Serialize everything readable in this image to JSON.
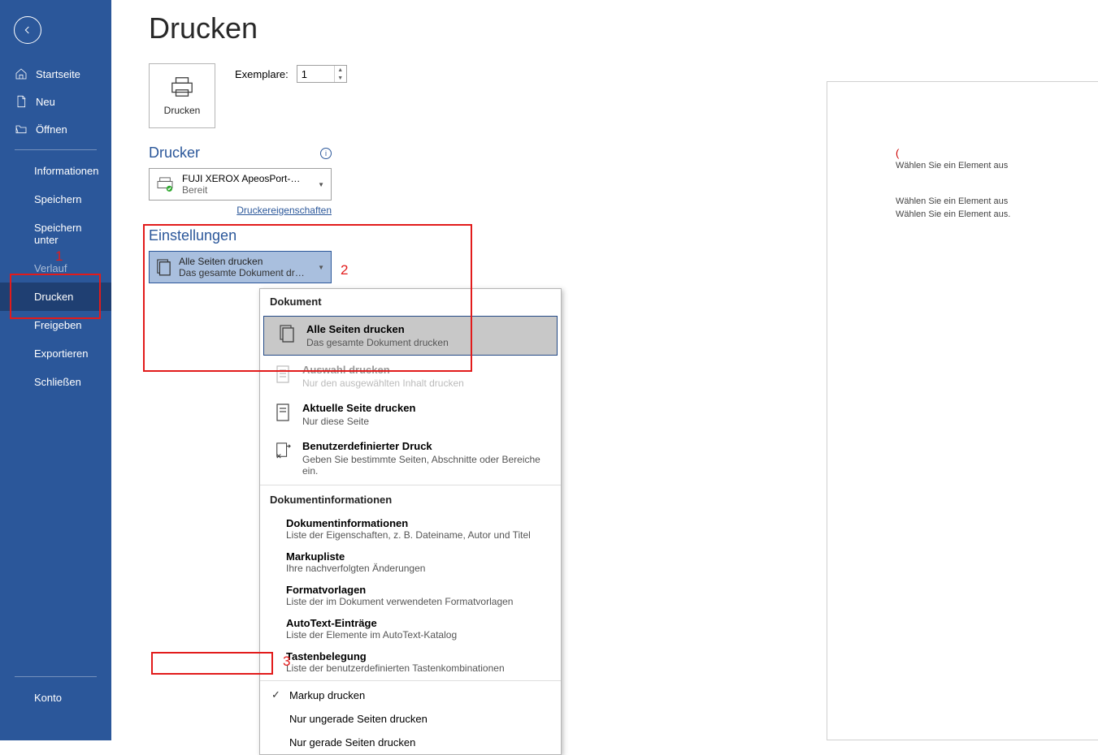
{
  "sidebar": {
    "items_icon": [
      {
        "label": "Startseite",
        "icon": "home"
      },
      {
        "label": "Neu",
        "icon": "page"
      },
      {
        "label": "Öffnen",
        "icon": "folder"
      }
    ],
    "items_text": [
      {
        "label": "Informationen"
      },
      {
        "label": "Speichern"
      },
      {
        "label": "Speichern unter"
      },
      {
        "label": "Verlauf",
        "dim": true
      },
      {
        "label": "Drucken",
        "active": true
      },
      {
        "label": "Freigeben"
      },
      {
        "label": "Exportieren"
      },
      {
        "label": "Schließen"
      }
    ],
    "footer": {
      "label": "Konto"
    }
  },
  "page": {
    "title": "Drucken"
  },
  "printbtn": {
    "label": "Drucken"
  },
  "copies": {
    "label": "Exemplare:",
    "value": "1"
  },
  "printer": {
    "section": "Drucker",
    "name": "FUJI XEROX ApeosPort-VI C…",
    "status": "Bereit",
    "props_link": "Druckereigenschaften"
  },
  "settings": {
    "section": "Einstellungen",
    "selected_title": "Alle Seiten drucken",
    "selected_sub": "Das gesamte Dokument dru…"
  },
  "popup": {
    "section1": "Dokument",
    "opts": [
      {
        "t1": "Alle Seiten drucken",
        "t2": "Das gesamte Dokument drucken",
        "selected": true
      },
      {
        "t1": "Auswahl drucken",
        "t2": "Nur den ausgewählten Inhalt drucken",
        "disabled": true
      },
      {
        "t1": "Aktuelle Seite drucken",
        "t2": "Nur diese Seite"
      },
      {
        "t1": "Benutzerdefinierter Druck",
        "t2": "Geben Sie bestimmte Seiten, Abschnitte oder Bereiche ein."
      }
    ],
    "section2": "Dokumentinformationen",
    "indent": [
      {
        "t1": "Dokumentinformationen",
        "t2": "Liste der Eigenschaften, z. B. Dateiname, Autor und Titel"
      },
      {
        "t1": "Markupliste",
        "t2": "Ihre nachverfolgten Änderungen"
      },
      {
        "t1": "Formatvorlagen",
        "t2": "Liste der im Dokument verwendeten Formatvorlagen"
      },
      {
        "t1": "AutoText-Einträge",
        "t2": "Liste der Elemente im AutoText-Katalog"
      },
      {
        "t1": "Tastenbelegung",
        "t2": "Liste der benutzerdefinierten Tastenkombinationen"
      }
    ],
    "checks": [
      {
        "label": "Markup drucken",
        "checked": true
      },
      {
        "label": "Nur ungerade Seiten drucken",
        "checked": false
      },
      {
        "label": "Nur gerade Seiten drucken",
        "checked": false
      }
    ]
  },
  "preview": {
    "paren": "(",
    "lines": [
      "Wählen Sie ein Element aus",
      "Wählen Sie ein Element aus",
      "Wählen Sie ein Element aus."
    ]
  },
  "annotations": {
    "n1": "1",
    "n2": "2",
    "n3": "3"
  }
}
